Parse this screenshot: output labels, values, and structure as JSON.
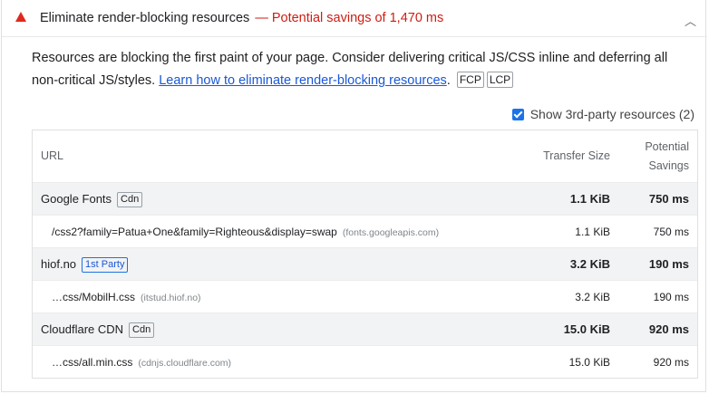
{
  "audit": {
    "title": "Eliminate render-blocking resources",
    "savings": "— Potential savings of 1,470 ms",
    "status_color": "#e0281d",
    "collapse_icon": "chevron-up-icon"
  },
  "description": {
    "text": "Resources are blocking the first paint of your page. Consider delivering critical JS/CSS inline and deferring all non-critical JS/styles.",
    "link_text": "Learn how to eliminate render-blocking resources",
    "period": ".",
    "chips": [
      "FCP",
      "LCP"
    ]
  },
  "third_party": {
    "label": "Show 3rd-party resources (2)",
    "checked": true
  },
  "table": {
    "headers": {
      "url": "URL",
      "size": "Transfer Size",
      "savings_line1": "Potential",
      "savings_line2": "Savings"
    },
    "groups": [
      {
        "name": "Google Fonts",
        "badge": "Cdn",
        "size": "1.1 KiB",
        "savings": "750 ms",
        "item": {
          "url": "/css2?family=Patua+One&family=Righteous&display=swap",
          "host": "(fonts.googleapis.com)",
          "size": "1.1 KiB",
          "savings": "750 ms"
        }
      },
      {
        "name": "hiof.no",
        "badge": "1st Party",
        "size": "3.2 KiB",
        "savings": "190 ms",
        "item": {
          "url": "…css/MobilH.css",
          "host": "(itstud.hiof.no)",
          "size": "3.2 KiB",
          "savings": "190 ms"
        }
      },
      {
        "name": "Cloudflare CDN",
        "badge": "Cdn",
        "size": "15.0 KiB",
        "savings": "920 ms",
        "item": {
          "url": "…css/all.min.css",
          "host": "(cdnjs.cloudflare.com)",
          "size": "15.0 KiB",
          "savings": "920 ms"
        }
      }
    ]
  }
}
